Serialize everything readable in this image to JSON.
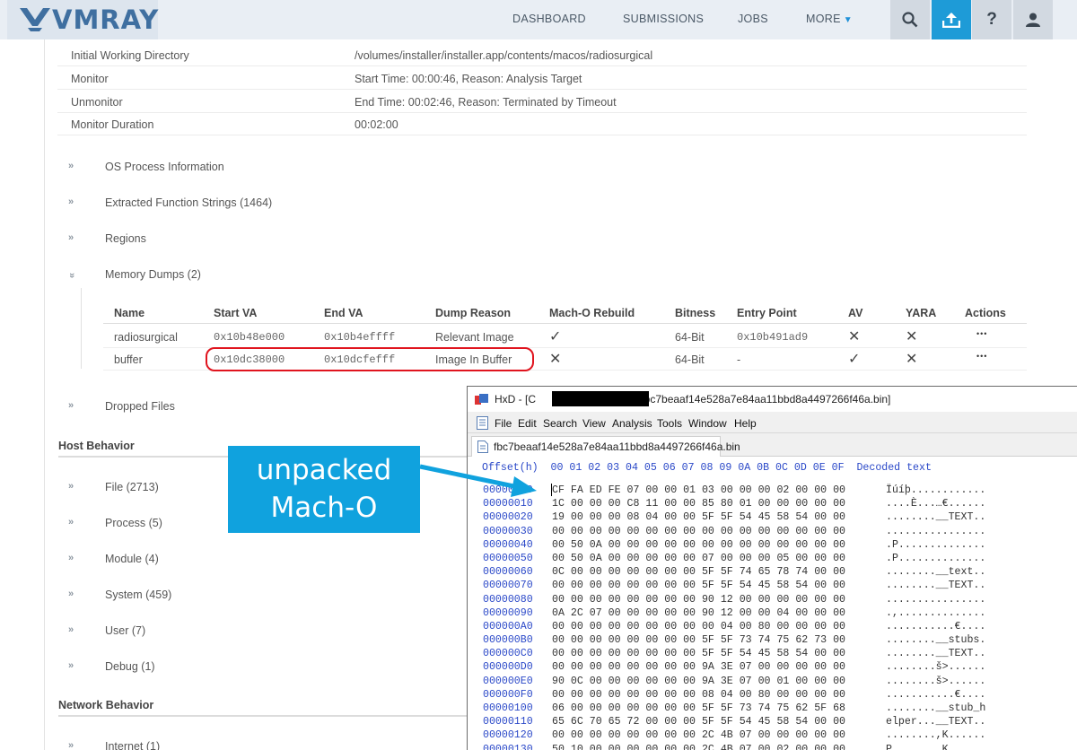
{
  "nav": {
    "logo_text": "VMRAY",
    "links": [
      "DASHBOARD",
      "SUBMISSIONS",
      "JOBS",
      "MORE"
    ],
    "icons": [
      "search-icon",
      "upload-icon",
      "help-icon",
      "user-icon"
    ],
    "accent": "#1e9bd7"
  },
  "details": [
    {
      "key": "Initial Working Directory",
      "value": "/volumes/installer/installer.app/contents/macos/radiosurgical"
    },
    {
      "key": "Monitor",
      "value": "Start Time: 00:00:46, Reason: Analysis Target"
    },
    {
      "key": "Unmonitor",
      "value": "End Time: 00:02:46, Reason: Terminated by Timeout"
    },
    {
      "key": "Monitor Duration",
      "value": "00:02:00"
    }
  ],
  "sections": {
    "os_process": "OS Process Information",
    "extracted_strings": "Extracted Function Strings (1464)",
    "regions": "Regions",
    "memory_dumps": "Memory Dumps (2)",
    "dropped_files": "Dropped Files"
  },
  "chevron_glyph": "»",
  "memory_table": {
    "headers": [
      "Name",
      "Start VA",
      "End VA",
      "Dump Reason",
      "Mach-O Rebuild",
      "Bitness",
      "Entry Point",
      "AV",
      "YARA",
      "Actions"
    ],
    "rows": [
      {
        "name": "radiosurgical",
        "start": "0x10b48e000",
        "end": "0x10b4effff",
        "reason": "Relevant Image",
        "macho": "✓",
        "bitness": "64-Bit",
        "entry": "0x10b491ad9",
        "av": "✕",
        "yara": "✕",
        "actions": "•••"
      },
      {
        "name": "buffer",
        "start": "0x10dc38000",
        "end": "0x10dcfefff",
        "reason": "Image In Buffer",
        "macho": "✕",
        "bitness": "64-Bit",
        "entry": "-",
        "av": "✓",
        "yara": "✕",
        "actions": "•••"
      }
    ]
  },
  "host_behavior": {
    "title": "Host Behavior",
    "items": [
      "File (2713)",
      "Process (5)",
      "Module (4)",
      "System (459)",
      "User (7)",
      "Debug (1)"
    ]
  },
  "network_behavior": {
    "title": "Network Behavior",
    "items": [
      "Internet (1)"
    ]
  },
  "callout": {
    "line1": "unpacked",
    "line2": "Mach-O",
    "color": "#10a2de"
  },
  "hxd": {
    "title_prefix": "HxD - [C",
    "title_suffix": "\\fbc7beaaf14e528a7e84aa11bbd8a4497266f46a.bin]",
    "menu": [
      "File",
      "Edit",
      "Search",
      "View",
      "Analysis",
      "Tools",
      "Window",
      "Help"
    ],
    "tab": "fbc7beaaf14e528a7e84aa11bbd8a4497266f46a.bin",
    "header": "Offset(h)  00 01 02 03 04 05 06 07 08 09 0A 0B 0C 0D 0E 0F  Decoded text",
    "rows": [
      {
        "off": "00000000",
        "bytes": "CF FA ED FE 07 00 00 01 03 00 00 00 02 00 00 00",
        "text": "Ïúíþ............"
      },
      {
        "off": "00000010",
        "bytes": "1C 00 00 00 C8 11 00 00 85 80 01 00 00 00 00 00",
        "text": "....È...…€......"
      },
      {
        "off": "00000020",
        "bytes": "19 00 00 00 08 04 00 00 5F 5F 54 45 58 54 00 00",
        "text": "........__TEXT.."
      },
      {
        "off": "00000030",
        "bytes": "00 00 00 00 00 00 00 00 00 00 00 00 00 00 00 00",
        "text": "................"
      },
      {
        "off": "00000040",
        "bytes": "00 50 0A 00 00 00 00 00 00 00 00 00 00 00 00 00",
        "text": ".P.............."
      },
      {
        "off": "00000050",
        "bytes": "00 50 0A 00 00 00 00 00 07 00 00 00 05 00 00 00",
        "text": ".P.............."
      },
      {
        "off": "00000060",
        "bytes": "0C 00 00 00 00 00 00 00 5F 5F 74 65 78 74 00 00",
        "text": "........__text.."
      },
      {
        "off": "00000070",
        "bytes": "00 00 00 00 00 00 00 00 5F 5F 54 45 58 54 00 00",
        "text": "........__TEXT.."
      },
      {
        "off": "00000080",
        "bytes": "00 00 00 00 00 00 00 00 90 12 00 00 00 00 00 00",
        "text": "................"
      },
      {
        "off": "00000090",
        "bytes": "0A 2C 07 00 00 00 00 00 90 12 00 00 04 00 00 00",
        "text": ".,.............."
      },
      {
        "off": "000000A0",
        "bytes": "00 00 00 00 00 00 00 00 00 04 00 80 00 00 00 00",
        "text": "...........€...."
      },
      {
        "off": "000000B0",
        "bytes": "00 00 00 00 00 00 00 00 5F 5F 73 74 75 62 73 00",
        "text": "........__stubs."
      },
      {
        "off": "000000C0",
        "bytes": "00 00 00 00 00 00 00 00 5F 5F 54 45 58 54 00 00",
        "text": "........__TEXT.."
      },
      {
        "off": "000000D0",
        "bytes": "00 00 00 00 00 00 00 00 9A 3E 07 00 00 00 00 00",
        "text": "........š>......"
      },
      {
        "off": "000000E0",
        "bytes": "90 0C 00 00 00 00 00 00 9A 3E 07 00 01 00 00 00",
        "text": "........š>......"
      },
      {
        "off": "000000F0",
        "bytes": "00 00 00 00 00 00 00 00 08 04 00 80 00 00 00 00",
        "text": "...........€...."
      },
      {
        "off": "00000100",
        "bytes": "06 00 00 00 00 00 00 00 5F 5F 73 74 75 62 5F 68",
        "text": "........__stub_h"
      },
      {
        "off": "00000110",
        "bytes": "65 6C 70 65 72 00 00 00 5F 5F 54 45 58 54 00 00",
        "text": "elper...__TEXT.."
      },
      {
        "off": "00000120",
        "bytes": "00 00 00 00 00 00 00 00 2C 4B 07 00 00 00 00 00",
        "text": "........,K......"
      },
      {
        "off": "00000130",
        "bytes": "50 10 00 00 00 00 00 00 2C 4B 07 00 02 00 00 00",
        "text": "P.......,K......"
      }
    ]
  }
}
